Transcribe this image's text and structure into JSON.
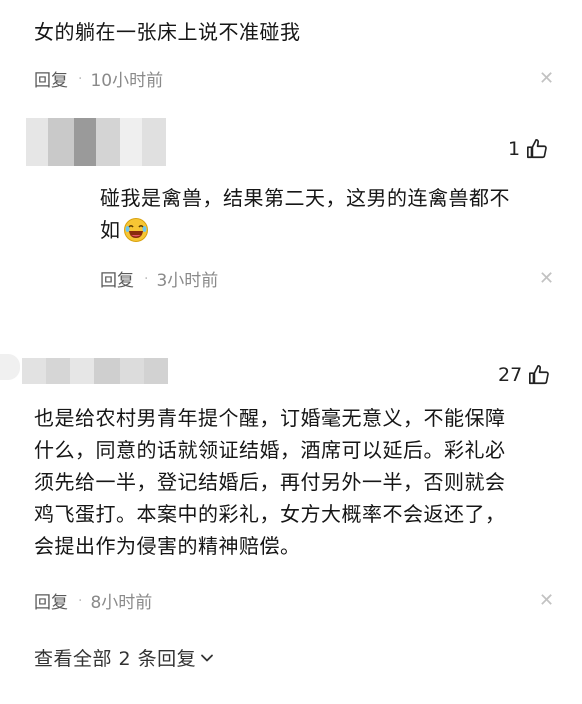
{
  "comment1": {
    "text": "女的躺在一张床上说不准碰我",
    "reply_label": "回复",
    "time": "10小时前"
  },
  "comment2": {
    "likes": "1",
    "text_line1": "碰我是禽兽，结果第二天，这男的连禽兽都不",
    "text_line2": "如",
    "emoji": "laughing-emoji",
    "reply_label": "回复",
    "time": "3小时前"
  },
  "comment3": {
    "likes": "27",
    "lines": [
      "也是给农村男青年提个醒，订婚毫无意义，不能保障",
      "什么，同意的话就领证结婚，酒席可以延后。彩礼必",
      "须先给一半，登记结婚后，再付另外一半，否则就会",
      "鸡飞蛋打。本案中的彩礼，女方大概率不会返还了，",
      "会提出作为侵害的精神赔偿。"
    ],
    "reply_label": "回复",
    "time": "8小时前"
  },
  "footer": {
    "view_all": "查看全部 2 条回复"
  },
  "icons": {
    "close": "close-icon",
    "like": "thumbs-up-icon",
    "expand": "chevron-down-icon"
  }
}
